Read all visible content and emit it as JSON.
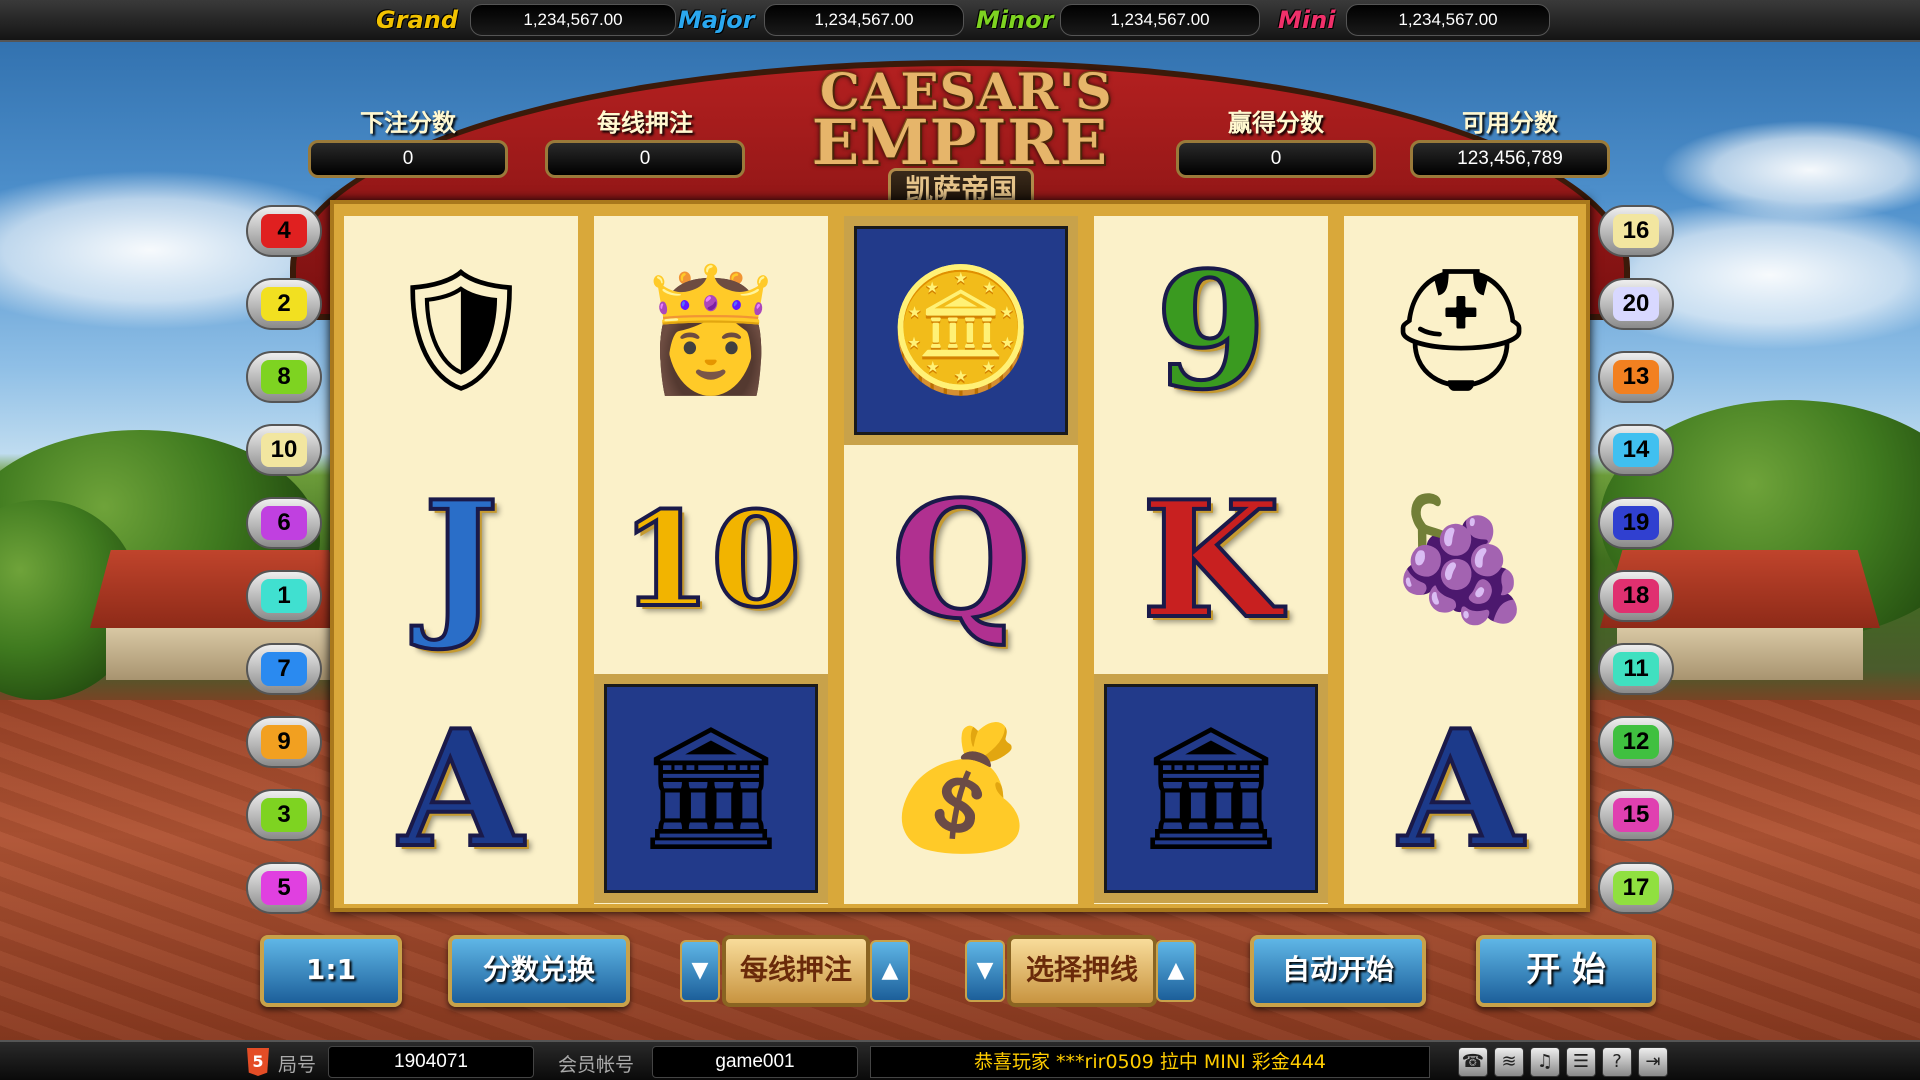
{
  "jackpots": [
    {
      "label": "Grand",
      "value": "1,234,567.00",
      "color": "#f2c200"
    },
    {
      "label": "Major",
      "value": "1,234,567.00",
      "color": "#2aa8f0"
    },
    {
      "label": "Minor",
      "value": "1,234,567.00",
      "color": "#7ed321"
    },
    {
      "label": "Mini",
      "value": "1,234,567.00",
      "color": "#f0306a"
    }
  ],
  "title": {
    "line1": "CAESAR'S",
    "line2": "EMPIRE",
    "cn": "凯萨帝国"
  },
  "scores": [
    {
      "label": "下注分数",
      "value": "0"
    },
    {
      "label": "每线押注",
      "value": "0"
    },
    {
      "label": "赢得分数",
      "value": "0"
    },
    {
      "label": "可用分数",
      "value": "123,456,789"
    }
  ],
  "reels": [
    [
      {
        "symbol": "shield-sword",
        "glyph": "🛡"
      },
      {
        "symbol": "J",
        "glyph": "J",
        "color": "#2a6ec8"
      },
      {
        "symbol": "A",
        "glyph": "A",
        "color": "#1c3a8a"
      }
    ],
    [
      {
        "symbol": "cleopatra",
        "glyph": "👸"
      },
      {
        "symbol": "10",
        "glyph": "10",
        "color": "#f2b400"
      },
      {
        "symbol": "colosseum",
        "glyph": "🏛"
      }
    ],
    [
      {
        "symbol": "gold-coin",
        "glyph": "🪙"
      },
      {
        "symbol": "Q",
        "glyph": "Q",
        "color": "#b03090"
      },
      {
        "symbol": "coin-bag",
        "glyph": "💰"
      }
    ],
    [
      {
        "symbol": "9",
        "glyph": "9",
        "color": "#3a9a20"
      },
      {
        "symbol": "K",
        "glyph": "K",
        "color": "#c82020"
      },
      {
        "symbol": "colosseum",
        "glyph": "🏛"
      }
    ],
    [
      {
        "symbol": "helmet",
        "glyph": "⛑"
      },
      {
        "symbol": "fruit-bowl",
        "glyph": "🍇"
      },
      {
        "symbol": "A",
        "glyph": "A",
        "color": "#1c3a8a"
      }
    ]
  ],
  "lines_left": [
    {
      "n": "4",
      "color": "#e02020"
    },
    {
      "n": "2",
      "color": "#f2e020"
    },
    {
      "n": "8",
      "color": "#7ed321"
    },
    {
      "n": "10",
      "color": "#f2e6a0"
    },
    {
      "n": "6",
      "color": "#c040e0"
    },
    {
      "n": "1",
      "color": "#40e0d0"
    },
    {
      "n": "7",
      "color": "#2a8af0"
    },
    {
      "n": "9",
      "color": "#f2a020"
    },
    {
      "n": "3",
      "color": "#7ed321"
    },
    {
      "n": "5",
      "color": "#e040e0"
    }
  ],
  "lines_right": [
    {
      "n": "16",
      "color": "#f2e6a0"
    },
    {
      "n": "20",
      "color": "#d8d8ff"
    },
    {
      "n": "13",
      "color": "#f28020"
    },
    {
      "n": "14",
      "color": "#40c0f0"
    },
    {
      "n": "19",
      "color": "#3040d0"
    },
    {
      "n": "18",
      "color": "#e03070"
    },
    {
      "n": "11",
      "color": "#40e0c0"
    },
    {
      "n": "12",
      "color": "#40c040"
    },
    {
      "n": "15",
      "color": "#e040b0"
    },
    {
      "n": "17",
      "color": "#90e040"
    }
  ],
  "controls": {
    "ratio": "1:1",
    "exchange": "分数兑换",
    "bet_per_line": "每线押注",
    "select_lines": "选择押线",
    "auto_start": "自动开始",
    "start": "开 始"
  },
  "status": {
    "round_label": "局号",
    "round_value": "1904071",
    "account_label": "会员帐号",
    "account_value": "game001",
    "marquee": "恭喜玩家 ***rir0509 拉中 MINI 彩金444"
  }
}
